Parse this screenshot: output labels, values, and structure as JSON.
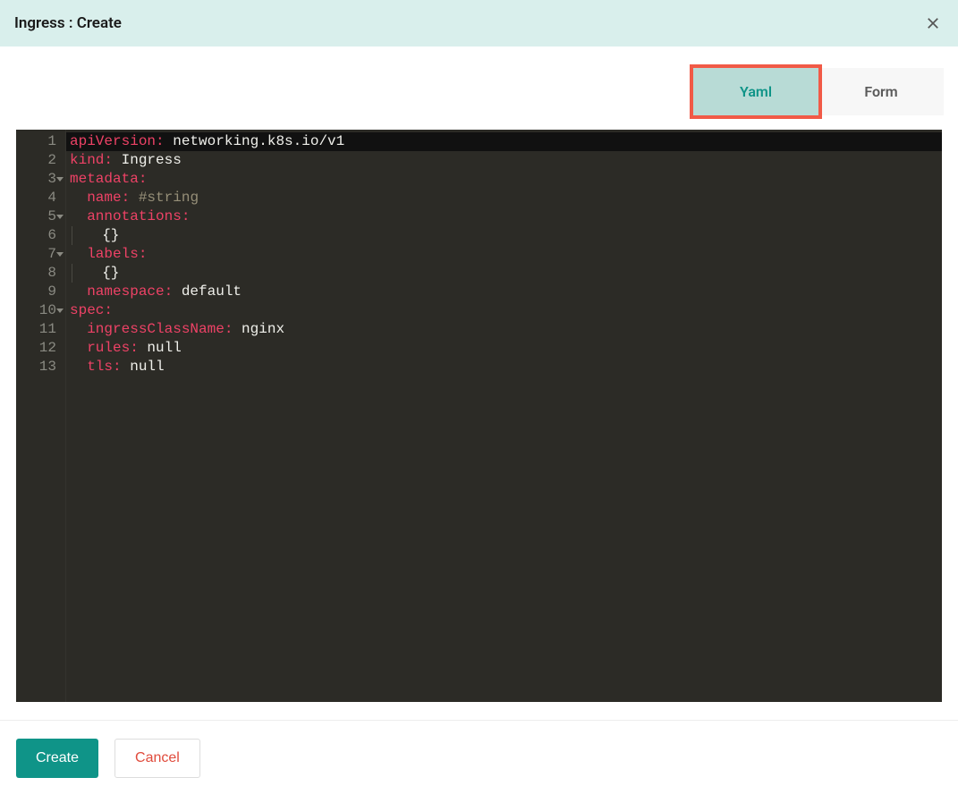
{
  "header": {
    "title": "Ingress : Create"
  },
  "tabs": {
    "yaml": "Yaml",
    "form": "Form",
    "active": "yaml"
  },
  "editor": {
    "lines": [
      {
        "n": 1,
        "fold": false,
        "active": true,
        "segs": [
          {
            "t": "apiVersion:",
            "c": "k"
          },
          {
            "t": " networking.k8s.io/v1",
            "c": "v"
          }
        ]
      },
      {
        "n": 2,
        "fold": false,
        "active": false,
        "segs": [
          {
            "t": "kind:",
            "c": "k"
          },
          {
            "t": " Ingress",
            "c": "v"
          }
        ]
      },
      {
        "n": 3,
        "fold": true,
        "active": false,
        "segs": [
          {
            "t": "metadata:",
            "c": "k"
          }
        ]
      },
      {
        "n": 4,
        "fold": false,
        "active": false,
        "segs": [
          {
            "t": "  ",
            "c": "v"
          },
          {
            "t": "name:",
            "c": "k"
          },
          {
            "t": " ",
            "c": "v"
          },
          {
            "t": "#string",
            "c": "c"
          }
        ]
      },
      {
        "n": 5,
        "fold": true,
        "active": false,
        "segs": [
          {
            "t": "  ",
            "c": "v"
          },
          {
            "t": "annotations:",
            "c": "k"
          }
        ]
      },
      {
        "n": 6,
        "fold": false,
        "active": false,
        "guide": true,
        "segs": [
          {
            "t": "{}",
            "c": "v"
          }
        ]
      },
      {
        "n": 7,
        "fold": true,
        "active": false,
        "segs": [
          {
            "t": "  ",
            "c": "v"
          },
          {
            "t": "labels:",
            "c": "k"
          }
        ]
      },
      {
        "n": 8,
        "fold": false,
        "active": false,
        "guide": true,
        "segs": [
          {
            "t": "{}",
            "c": "v"
          }
        ]
      },
      {
        "n": 9,
        "fold": false,
        "active": false,
        "segs": [
          {
            "t": "  ",
            "c": "v"
          },
          {
            "t": "namespace:",
            "c": "k"
          },
          {
            "t": " default",
            "c": "v"
          }
        ]
      },
      {
        "n": 10,
        "fold": true,
        "active": false,
        "segs": [
          {
            "t": "spec:",
            "c": "k"
          }
        ]
      },
      {
        "n": 11,
        "fold": false,
        "active": false,
        "segs": [
          {
            "t": "  ",
            "c": "v"
          },
          {
            "t": "ingressClassName:",
            "c": "k"
          },
          {
            "t": " nginx",
            "c": "v"
          }
        ]
      },
      {
        "n": 12,
        "fold": false,
        "active": false,
        "segs": [
          {
            "t": "  ",
            "c": "v"
          },
          {
            "t": "rules:",
            "c": "k"
          },
          {
            "t": " null",
            "c": "v"
          }
        ]
      },
      {
        "n": 13,
        "fold": false,
        "active": false,
        "segs": [
          {
            "t": "  ",
            "c": "v"
          },
          {
            "t": "tls:",
            "c": "k"
          },
          {
            "t": " null",
            "c": "v"
          }
        ]
      }
    ]
  },
  "footer": {
    "create": "Create",
    "cancel": "Cancel"
  }
}
